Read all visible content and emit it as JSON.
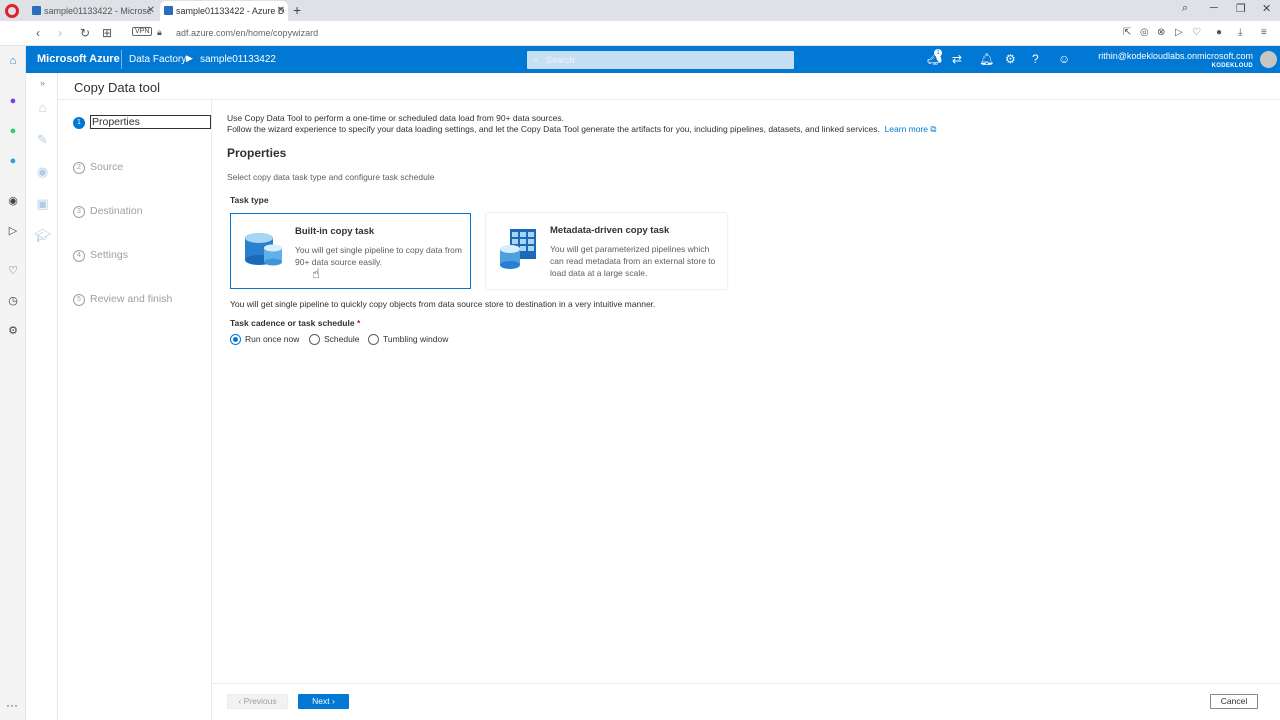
{
  "browser": {
    "tabs": [
      {
        "title": "sample01133422 - Microsc"
      },
      {
        "title": "sample01133422 - Azure D"
      }
    ],
    "new_tab": "+",
    "vpn": "VPN",
    "url": "adf.azure.com/en/home/copywizard"
  },
  "azure": {
    "brand": "Microsoft Azure",
    "breadcrumb": [
      "Data Factory",
      "sample01133422"
    ],
    "search_placeholder": "Search",
    "notification_count": "1",
    "user_email": "rithin@kodekloudlabs.onmicrosoft.com",
    "user_org": "KODEKLOUD"
  },
  "page": {
    "title": "Copy Data tool"
  },
  "steps": [
    {
      "num": "1",
      "label": "Properties"
    },
    {
      "num": "2",
      "label": "Source"
    },
    {
      "num": "3",
      "label": "Destination"
    },
    {
      "num": "4",
      "label": "Settings"
    },
    {
      "num": "5",
      "label": "Review and finish"
    }
  ],
  "content": {
    "intro_line1": "Use Copy Data Tool to perform a one-time or scheduled data load from 90+ data sources.",
    "intro_line2": "Follow the wizard experience to specify your data loading settings, and let the Copy Data Tool generate the artifacts for you, including pipelines, datasets, and linked services.",
    "learn_more": "Learn more",
    "section_title": "Properties",
    "section_subtitle": "Select copy data task type and configure task schedule",
    "task_type_label": "Task type",
    "cards": [
      {
        "title": "Built-in copy task",
        "desc": "You will get single pipeline to copy data from 90+ data source easily."
      },
      {
        "title": "Metadata-driven copy task",
        "desc": "You will get parameterized pipelines which can read metadata from an external store to load data at a large scale."
      }
    ],
    "task_desc": "You will get single pipeline to quickly copy objects from data source store to destination in a very intuitive manner.",
    "cadence_label": "Task cadence or task schedule",
    "required_mark": "*",
    "radios": [
      {
        "label": "Run once now",
        "selected": true
      },
      {
        "label": "Schedule",
        "selected": false
      },
      {
        "label": "Tumbling window",
        "selected": false
      }
    ]
  },
  "footer": {
    "previous": "Previous",
    "next": "Next",
    "cancel": "Cancel"
  },
  "colors": {
    "azure_blue": "#0078d4"
  }
}
